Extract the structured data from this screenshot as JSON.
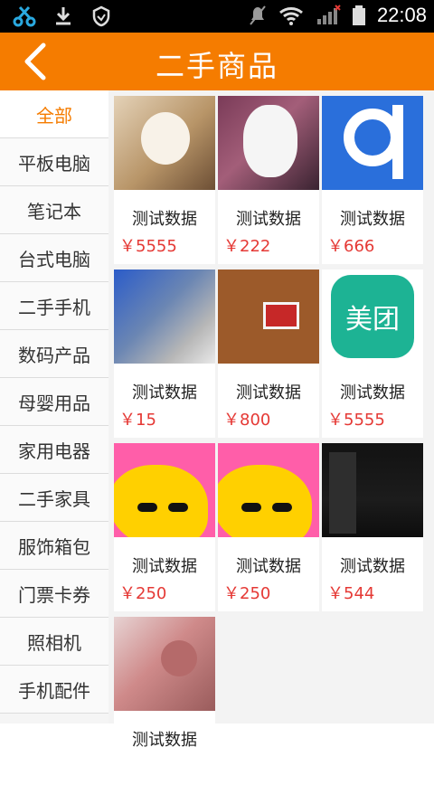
{
  "status_bar": {
    "icons": [
      "scissors-icon",
      "download-icon",
      "shield-icon",
      "mute-icon",
      "wifi-icon",
      "signal-icon",
      "battery-icon"
    ],
    "time": "22:08"
  },
  "header": {
    "title": "二手商品",
    "back_icon": "chevron-left-icon",
    "accent_color": "#f57c00"
  },
  "sidebar": {
    "items": [
      {
        "label": "全部",
        "active": true
      },
      {
        "label": "平板电脑"
      },
      {
        "label": "笔记本"
      },
      {
        "label": "台式电脑"
      },
      {
        "label": "二手手机"
      },
      {
        "label": "数码产品"
      },
      {
        "label": "母婴用品"
      },
      {
        "label": "家用电器"
      },
      {
        "label": "二手家具"
      },
      {
        "label": "服饰箱包"
      },
      {
        "label": "门票卡券"
      },
      {
        "label": "照相机"
      },
      {
        "label": "手机配件"
      }
    ]
  },
  "products": [
    {
      "name": "测试数据",
      "price": "￥5555"
    },
    {
      "name": "测试数据",
      "price": "￥222"
    },
    {
      "name": "测试数据",
      "price": "￥666"
    },
    {
      "name": "测试数据",
      "price": "￥15"
    },
    {
      "name": "测试数据",
      "price": "￥800"
    },
    {
      "name": "测试数据",
      "price": "￥5555",
      "thumb_text": "美团"
    },
    {
      "name": "测试数据",
      "price": "￥250"
    },
    {
      "name": "测试数据",
      "price": "￥250"
    },
    {
      "name": "测试数据",
      "price": "￥544"
    },
    {
      "name": "测试数据",
      "price": "",
      "partial": true
    }
  ],
  "colors": {
    "accent": "#f57c00",
    "price": "#e53935"
  }
}
